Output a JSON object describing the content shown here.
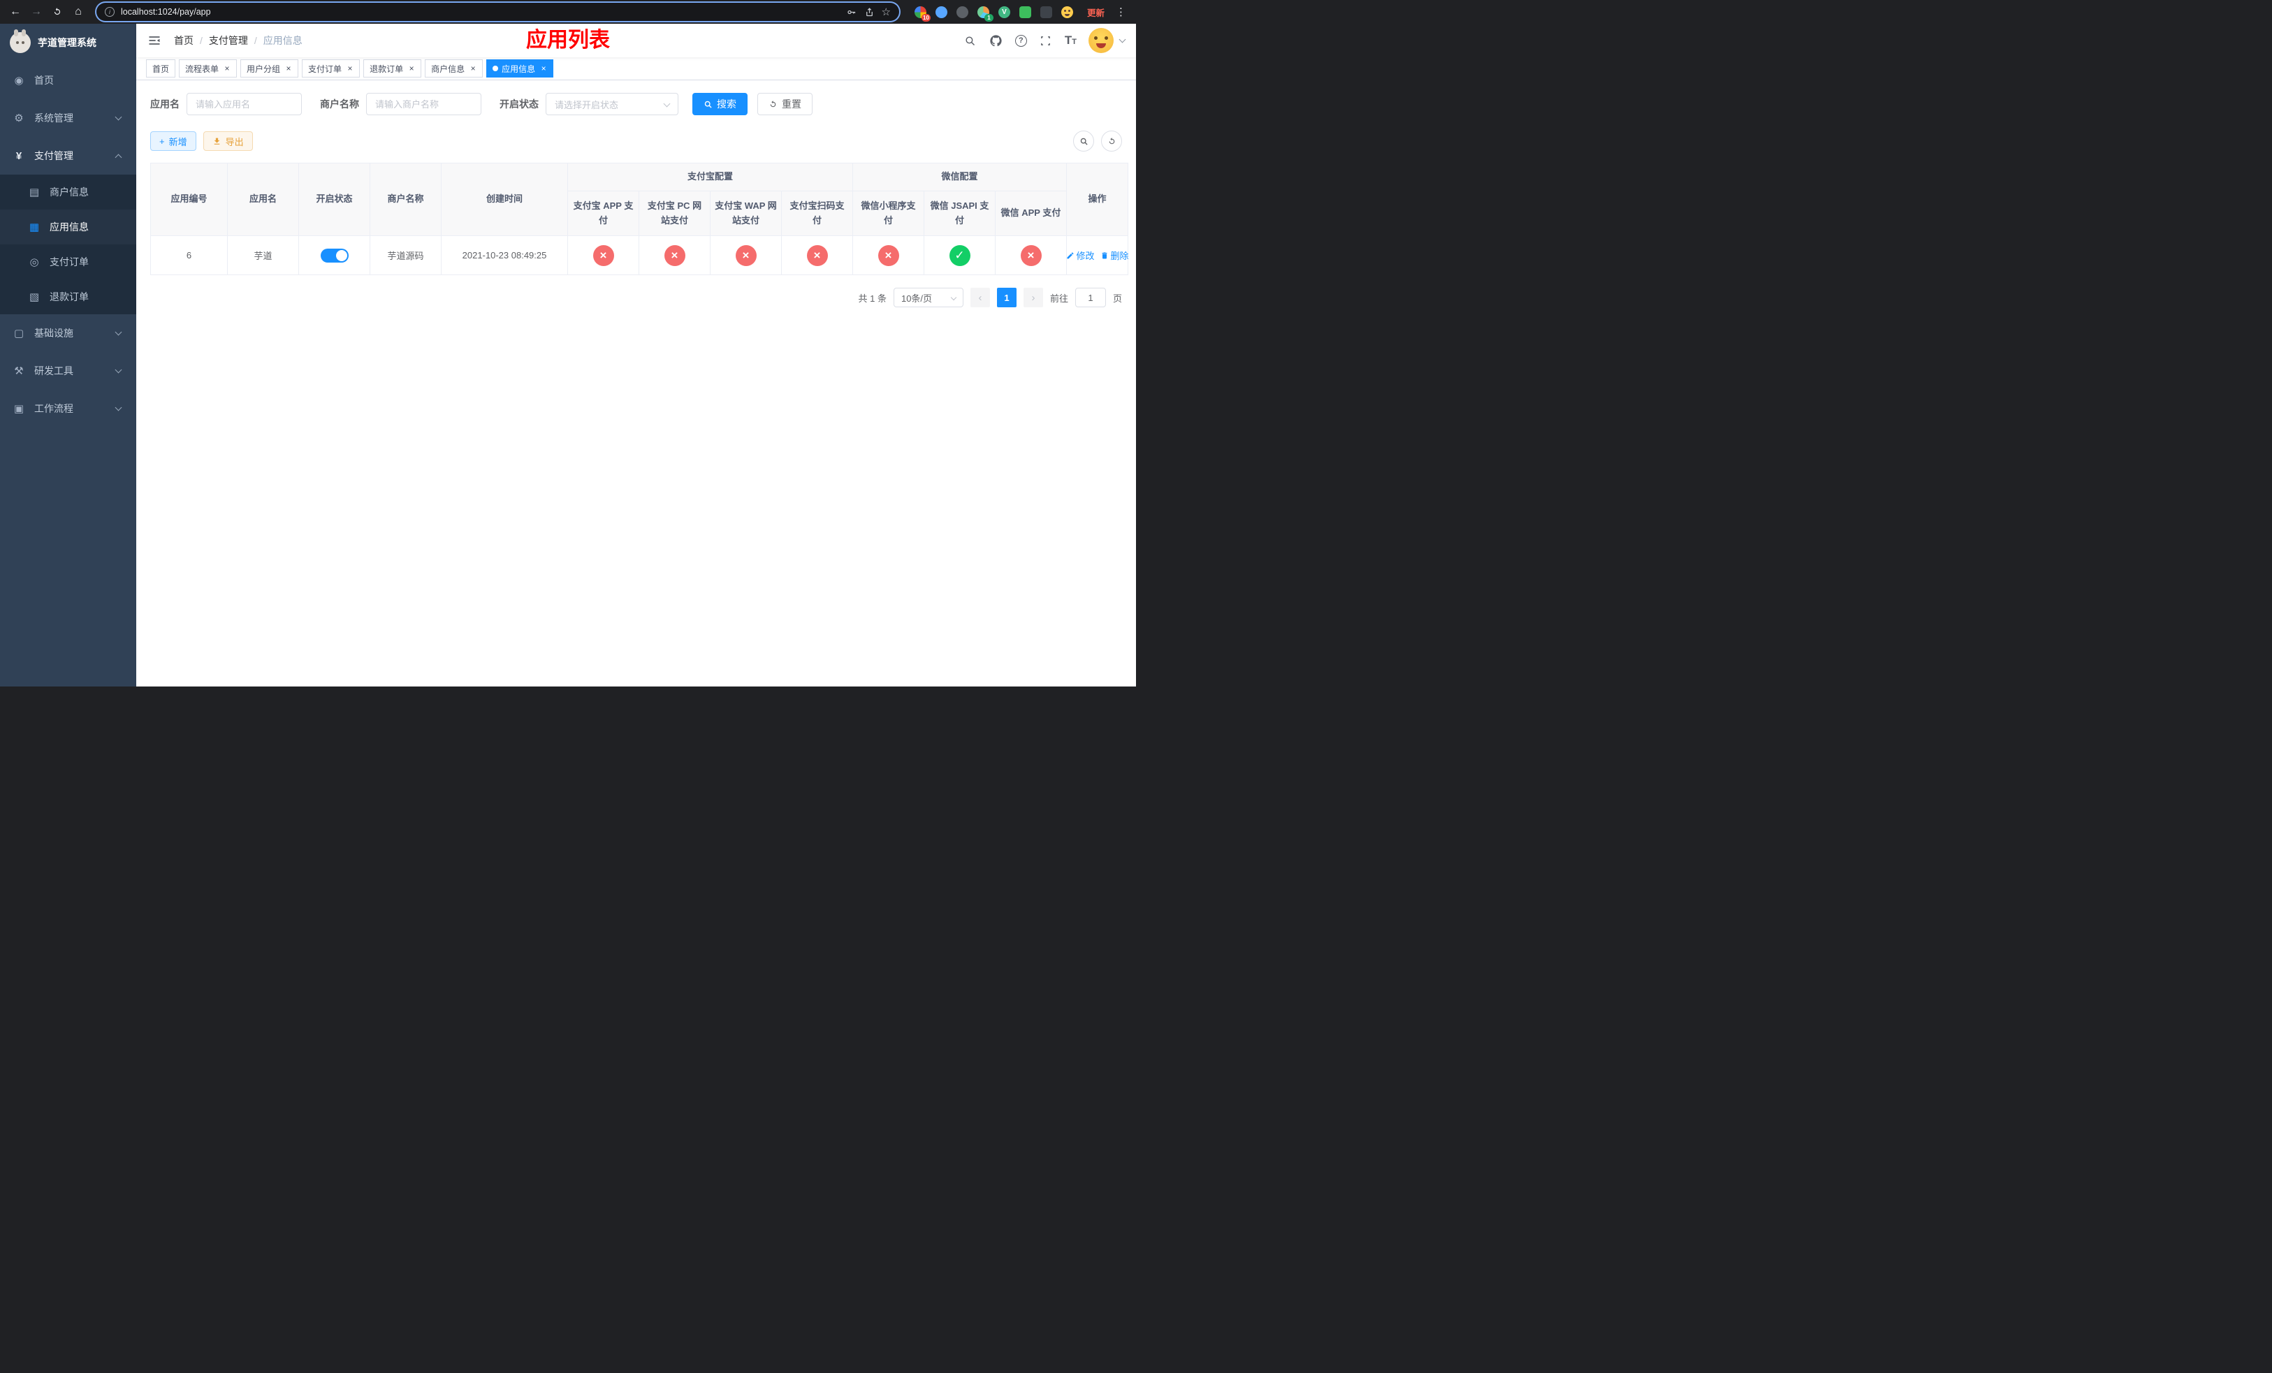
{
  "browser": {
    "url": "localhost:1024/pay/app",
    "update_label": "更新",
    "extensions": [
      {
        "name": "extension-puzzle",
        "shape": "circle",
        "color": "conic-gradient(#ea4335 0 25%, #fbbc05 25% 50%, #34a853 50% 75%, #4285f4 75% 100%)",
        "badge": "10",
        "badge_color": "#e8453c",
        "label": ""
      },
      {
        "name": "extension-water-drop",
        "shape": "circle",
        "color": "#58a6ff",
        "badge": "",
        "badge_color": "",
        "label": ""
      },
      {
        "name": "extension-dark-circle",
        "shape": "circle",
        "color": "#5c6167",
        "badge": "",
        "badge_color": "",
        "label": ""
      },
      {
        "name": "extension-color-wheel",
        "shape": "circle",
        "color": "conic-gradient(#f2994a 0 30%, #56ccf2 30% 60%, #6fcf97 60% 100%)",
        "badge": "1",
        "badge_color": "#1fa463",
        "label": ""
      },
      {
        "name": "extension-vue-devtools",
        "shape": "circle",
        "color": "#41b883",
        "badge": "",
        "badge_color": "",
        "label": "V"
      },
      {
        "name": "extension-green-chat",
        "shape": "square",
        "color": "#3dbd5d",
        "badge": "",
        "badge_color": "",
        "label": ""
      },
      {
        "name": "extension-dark-square",
        "shape": "square",
        "color": "#3e434a",
        "badge": "",
        "badge_color": "",
        "label": ""
      },
      {
        "name": "extension-emoji-face",
        "shape": "face",
        "color": "#ffcc4d",
        "badge": "",
        "badge_color": "",
        "label": ""
      }
    ]
  },
  "icons": {
    "back": "←",
    "forward": "→",
    "home": "⌂",
    "star": "☆",
    "kebab": "⋮",
    "info": "i",
    "close": "×",
    "check": "✓",
    "cross": "×",
    "plus": "+",
    "prev": "‹",
    "next": "›",
    "question": "?",
    "font_large": "T",
    "font_small": "T"
  },
  "sidebar": {
    "title": "芋道管理系统",
    "menu": [
      {
        "key": "home",
        "label": "首页",
        "icon": "dashboard-icon",
        "glyph": "◉",
        "type": "item"
      },
      {
        "key": "system",
        "label": "系统管理",
        "icon": "gear-icon",
        "glyph": "⚙",
        "type": "parent",
        "expanded": false
      },
      {
        "key": "payment",
        "label": "支付管理",
        "icon": "yen-icon",
        "glyph": "¥",
        "type": "parent",
        "expanded": true,
        "children": [
          {
            "key": "merchant-info",
            "label": "商户信息",
            "icon": "bank-card-icon",
            "glyph": "▤",
            "active": false
          },
          {
            "key": "app-info",
            "label": "应用信息",
            "icon": "grid-icon",
            "glyph": "▦",
            "active": true
          },
          {
            "key": "pay-order",
            "label": "支付订单",
            "icon": "order-icon",
            "glyph": "◎",
            "active": false
          },
          {
            "key": "refund-order",
            "label": "退款订单",
            "icon": "refund-doc-icon",
            "glyph": "▧",
            "active": false
          }
        ]
      },
      {
        "key": "infrastructure",
        "label": "基础设施",
        "icon": "infrastructure-icon",
        "glyph": "▢",
        "type": "parent",
        "expanded": false
      },
      {
        "key": "dev-tools",
        "label": "研发工具",
        "icon": "toolbox-icon",
        "glyph": "⚒",
        "type": "parent",
        "expanded": false
      },
      {
        "key": "workflow",
        "label": "工作流程",
        "icon": "workflow-icon",
        "glyph": "▣",
        "type": "parent",
        "expanded": false
      }
    ]
  },
  "header": {
    "breadcrumb": [
      "首页",
      "支付管理",
      "应用信息"
    ],
    "page_title": "应用列表"
  },
  "tabs": [
    {
      "label": "首页",
      "closable": false,
      "active": false
    },
    {
      "label": "流程表单",
      "closable": true,
      "active": false
    },
    {
      "label": "用户分组",
      "closable": true,
      "active": false
    },
    {
      "label": "支付订单",
      "closable": true,
      "active": false
    },
    {
      "label": "退款订单",
      "closable": true,
      "active": false
    },
    {
      "label": "商户信息",
      "closable": true,
      "active": false
    },
    {
      "label": "应用信息",
      "closable": true,
      "active": true
    }
  ],
  "filters": {
    "app_name_label": "应用名",
    "app_name_placeholder": "请输入应用名",
    "merchant_label": "商户名称",
    "merchant_placeholder": "请输入商户名称",
    "status_label": "开启状态",
    "status_placeholder": "请选择开启状态",
    "search_label": "搜索",
    "reset_label": "重置"
  },
  "toolbar": {
    "add_label": "新增",
    "export_label": "导出"
  },
  "table": {
    "groups": {
      "alipay": "支付宝配置",
      "wechat": "微信配置"
    },
    "columns": [
      "应用编号",
      "应用名",
      "开启状态",
      "商户名称",
      "创建时间",
      "支付宝 APP 支付",
      "支付宝 PC 网站支付",
      "支付宝 WAP 网站支付",
      "支付宝扫码支付",
      "微信小程序支付",
      "微信 JSAPI 支付",
      "微信 APP 支付",
      "操作"
    ],
    "rows": [
      {
        "id": "6",
        "name": "芋道",
        "enabled": true,
        "merchant": "芋道源码",
        "created": "2021-10-23 08:49:25",
        "statuses": [
          false,
          false,
          false,
          false,
          false,
          true,
          false
        ],
        "edit_label": "修改",
        "delete_label": "删除"
      }
    ]
  },
  "pagination": {
    "total_label": "共 1 条",
    "page_size_label": "10条/页",
    "current_page": "1",
    "goto_prefix": "前往",
    "goto_value": "1",
    "goto_suffix": "页"
  },
  "colors": {
    "accent": "#1890ff",
    "fail": "#f56c6c",
    "ok": "#13ce66",
    "sidebar_bg": "#304156",
    "submenu_bg": "#1f2d3d",
    "title_red": "#ff0000"
  }
}
